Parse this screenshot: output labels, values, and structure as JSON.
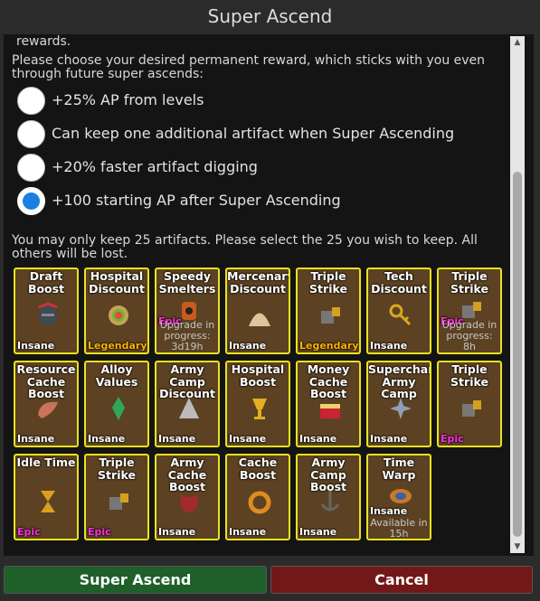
{
  "dialog": {
    "title": "Super Ascend",
    "cut_off_text": "rewards.",
    "intro": "Please choose your desired permanent reward, which sticks with you even through future super ascends:",
    "options": [
      {
        "label": "+25% AP from levels",
        "selected": false
      },
      {
        "label": "Can keep one additional artifact when Super Ascending",
        "selected": false
      },
      {
        "label": "+20% faster artifact digging",
        "selected": false
      },
      {
        "label": "+100 starting AP after Super Ascending",
        "selected": true
      }
    ],
    "keep_note": "You may only keep 25 artifacts.  Please select the 25 you wish to keep.  All others will be lost."
  },
  "artifacts": [
    {
      "name": "Draft Boost",
      "rarity": "Insane",
      "status": "",
      "icon": "gladiator-helmet-icon"
    },
    {
      "name": "Hospital Discount",
      "rarity": "Legendary",
      "status": "",
      "icon": "ring-icon"
    },
    {
      "name": "Speedy Smelters",
      "rarity": "Epic",
      "status": "Upgrade in progress: 3d19h",
      "icon": "furnace-icon"
    },
    {
      "name": "Mercenary Discount",
      "rarity": "Insane",
      "status": "",
      "icon": "sand-pile-icon"
    },
    {
      "name": "Triple Strike",
      "rarity": "Legendary",
      "status": "",
      "icon": "gauntlet-icon"
    },
    {
      "name": "Tech Discount",
      "rarity": "Insane",
      "status": "",
      "icon": "key-icon"
    },
    {
      "name": "Triple Strike",
      "rarity": "Epic",
      "status": "Upgrade in progress: 8h",
      "icon": "gauntlet-icon"
    },
    {
      "name": "Resource Cache Boost",
      "rarity": "Insane",
      "status": "",
      "icon": "horn-icon"
    },
    {
      "name": "Alloy Values",
      "rarity": "Insane",
      "status": "",
      "icon": "crystal-icon"
    },
    {
      "name": "Army Camp Discount",
      "rarity": "Insane",
      "status": "",
      "icon": "tent-icon"
    },
    {
      "name": "Hospital Boost",
      "rarity": "Insane",
      "status": "",
      "icon": "goblet-icon"
    },
    {
      "name": "Money Cache Boost",
      "rarity": "Insane",
      "status": "",
      "icon": "cake-icon"
    },
    {
      "name": "Supercharge Army Camp",
      "rarity": "Insane",
      "status": "",
      "icon": "shuriken-icon"
    },
    {
      "name": "Triple Strike",
      "rarity": "Epic",
      "status": "",
      "icon": "gauntlet-icon"
    },
    {
      "name": "Idle Time",
      "rarity": "Epic",
      "status": "",
      "icon": "hourglass-icon"
    },
    {
      "name": "Triple Strike",
      "rarity": "Epic",
      "status": "",
      "icon": "gauntlet-icon"
    },
    {
      "name": "Army Cache Boost",
      "rarity": "Insane",
      "status": "",
      "icon": "demon-mask-icon"
    },
    {
      "name": "Cache Boost",
      "rarity": "Insane",
      "status": "",
      "icon": "gold-ring-icon"
    },
    {
      "name": "Army Camp Boost",
      "rarity": "Insane",
      "status": "",
      "icon": "anchor-icon"
    },
    {
      "name": "Time Warp",
      "rarity": "Insane",
      "status": "Available in 15h",
      "icon": "warp-drum-icon"
    }
  ],
  "buttons": {
    "ascend": "Super Ascend",
    "cancel": "Cancel"
  },
  "colors": {
    "card_bg": "#5c4223",
    "card_border": "#e9e21e",
    "insane": "#ffffff",
    "legendary": "#ffb300",
    "epic": "#ff2fe0",
    "radio_selected": "#1a7fe0",
    "ascend_button": "#1e5f2a",
    "cancel_button": "#731818"
  }
}
